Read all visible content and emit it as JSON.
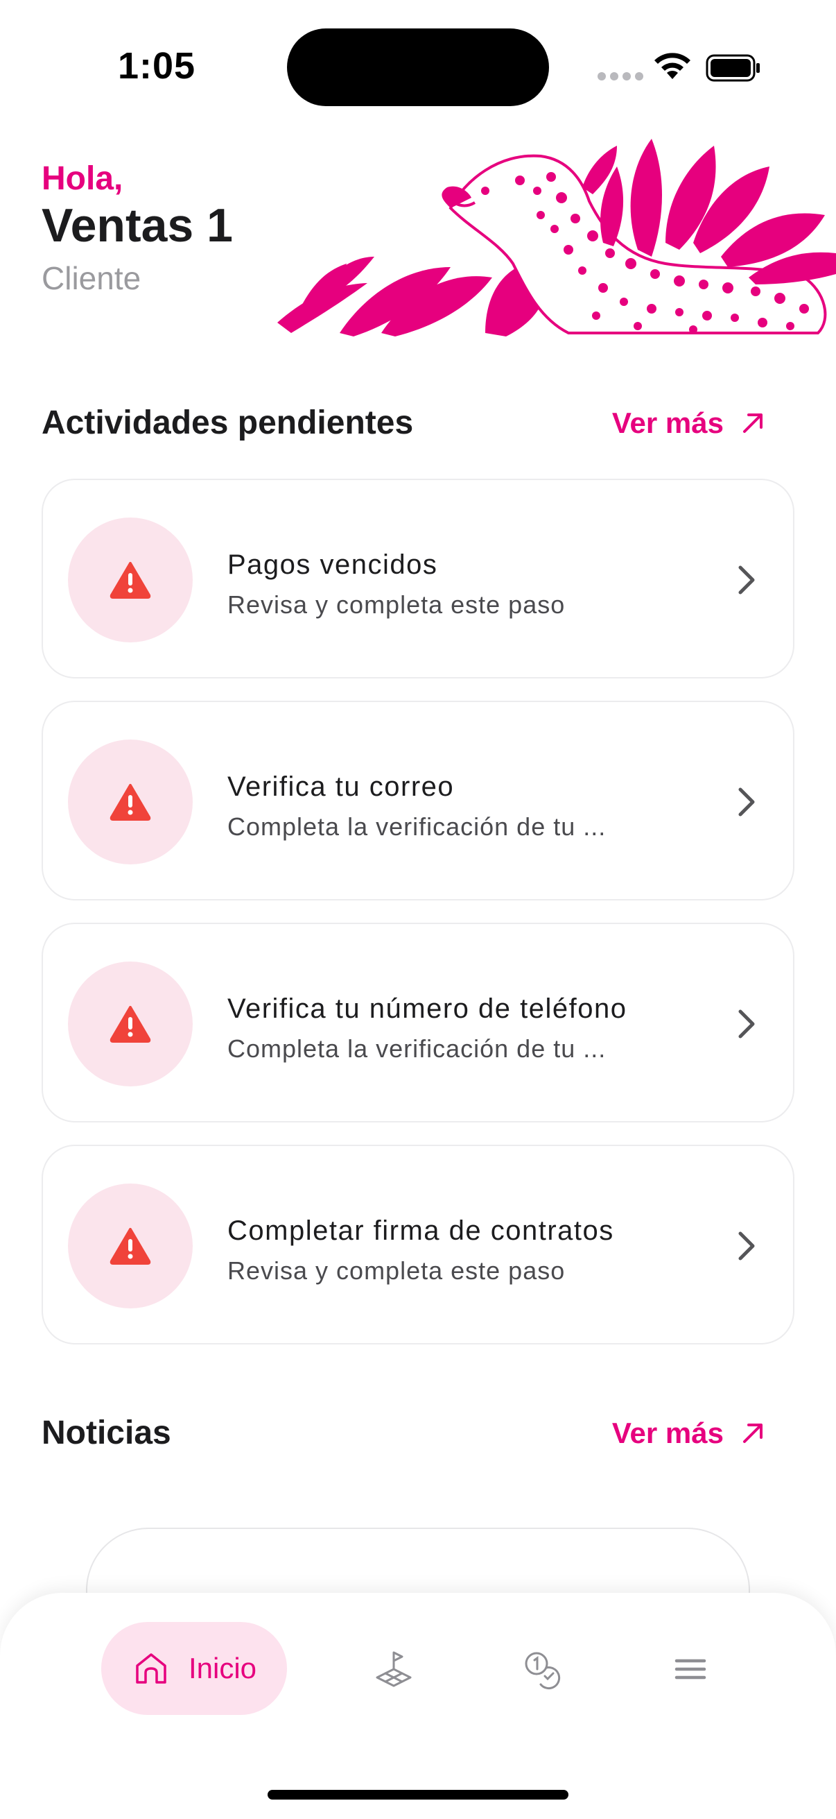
{
  "status_bar": {
    "time": "1:05",
    "icons": [
      "signal-icon",
      "wifi-icon",
      "battery-icon"
    ]
  },
  "greeting": {
    "hello": "Hola,",
    "user_name": "Ventas 1",
    "role": "Cliente"
  },
  "activities": {
    "title": "Actividades pendientes",
    "see_more": "Ver más",
    "items": [
      {
        "title": "Pagos vencidos",
        "subtitle": "Revisa y completa este paso",
        "icon": "warning-icon"
      },
      {
        "title": "Verifica tu correo",
        "subtitle": "Completa la verificación de tu ...",
        "icon": "warning-icon"
      },
      {
        "title": "Verifica tu número de teléfono",
        "subtitle": "Completa la verificación de tu ...",
        "icon": "warning-icon"
      },
      {
        "title": "Completar firma de contratos",
        "subtitle": "Revisa y completa este paso",
        "icon": "warning-icon"
      }
    ]
  },
  "news": {
    "title": "Noticias",
    "see_more": "Ver más"
  },
  "bottom_nav": {
    "items": [
      {
        "label": "Inicio",
        "icon": "home-icon",
        "active": true
      },
      {
        "label": "",
        "icon": "land-flag-icon",
        "active": false
      },
      {
        "label": "",
        "icon": "payments-icon",
        "active": false
      },
      {
        "label": "",
        "icon": "menu-icon",
        "active": false
      }
    ]
  },
  "colors": {
    "accent": "#e6007e",
    "warning": "#f0433a",
    "icon_bg": "#fbe4ec",
    "nav_active_bg": "#fde2ee"
  }
}
